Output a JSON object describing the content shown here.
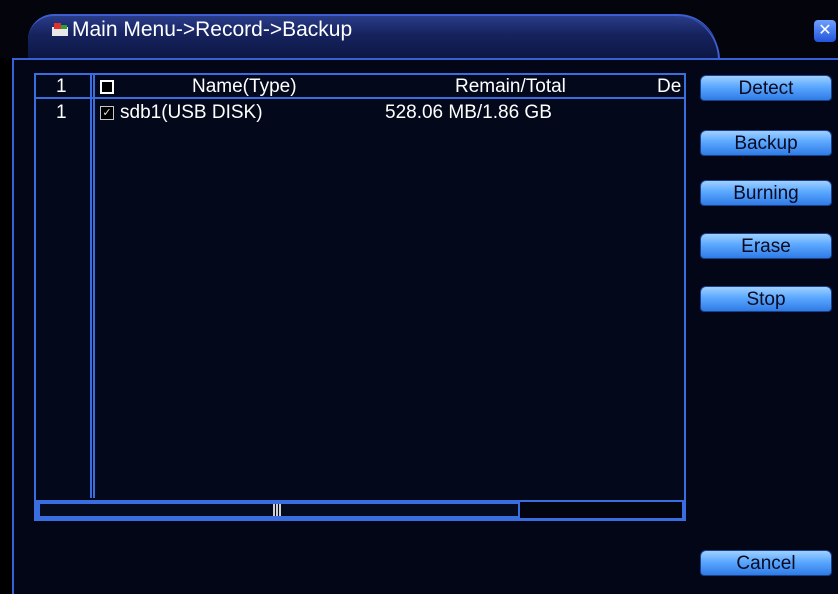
{
  "window": {
    "title": "Main Menu->Record->Backup",
    "close_icon": "close-icon"
  },
  "table": {
    "headers": {
      "index": "1",
      "name": "Name(Type)",
      "remain_total": "Remain/Total",
      "device": "De"
    },
    "rows": [
      {
        "index": "1",
        "checked": true,
        "name": "sdb1(USB DISK)",
        "remain_total": "528.06 MB/1.86 GB"
      }
    ]
  },
  "buttons": {
    "detect": "Detect",
    "backup": "Backup",
    "burning": "Burning",
    "erase": "Erase",
    "stop": "Stop",
    "cancel": "Cancel"
  },
  "colors": {
    "accent_border": "#3a6ee0",
    "button_blue": "#5aa8ff",
    "panel_bg": "#020617"
  }
}
